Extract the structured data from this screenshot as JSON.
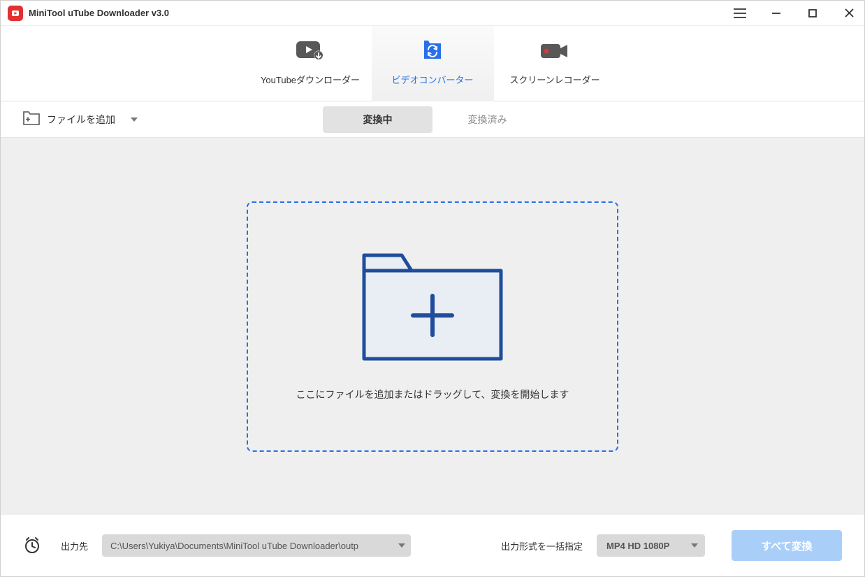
{
  "app": {
    "title": "MiniTool uTube Downloader v3.0"
  },
  "tabs": {
    "main": [
      {
        "label": "YouTubeダウンローダー"
      },
      {
        "label": "ビデオコンバーター"
      },
      {
        "label": "スクリーンレコーダー"
      }
    ],
    "sub": [
      {
        "label": "変換中"
      },
      {
        "label": "変換済み"
      }
    ]
  },
  "toolbar": {
    "add_file": "ファイルを追加"
  },
  "dropzone": {
    "hint": "ここにファイルを追加またはドラッグして、変換を開始します"
  },
  "bottom": {
    "output_label": "出力先",
    "output_path": "C:\\Users\\Yukiya\\Documents\\MiniTool uTube Downloader\\outp",
    "format_label": "出力形式を一括指定",
    "format_value": "MP4 HD 1080P",
    "convert_all": "すべて変換"
  }
}
